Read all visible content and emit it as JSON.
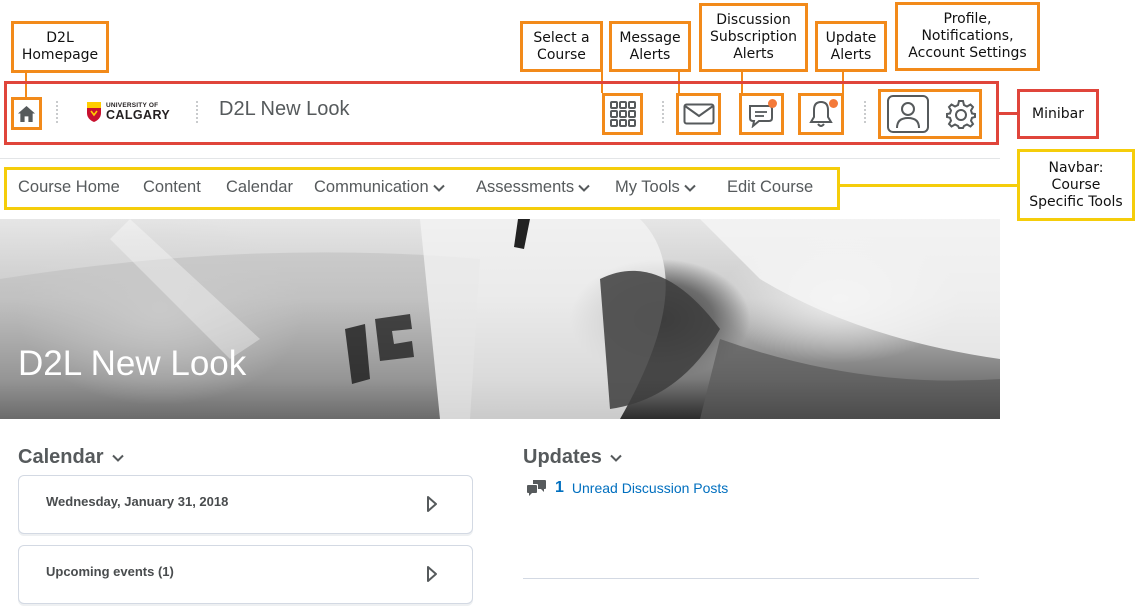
{
  "callouts": {
    "homepage": "D2L\nHomepage",
    "select_course": "Select a\nCourse",
    "message_alerts": "Message\nAlerts",
    "discussion_alerts": "Discussion\nSubscription\nAlerts",
    "update_alerts": "Update\nAlerts",
    "profile": "Profile,\nNotifications,\nAccount Settings",
    "minibar": "Minibar",
    "navbar": "Navbar:\nCourse\nSpecific Tools"
  },
  "minibar": {
    "logo_small": "UNIVERSITY OF",
    "logo_big": "CALGARY",
    "course_title": "D2L New Look"
  },
  "navbar": {
    "items": [
      {
        "label": "Course Home"
      },
      {
        "label": "Content"
      },
      {
        "label": "Calendar"
      },
      {
        "label": "Communication"
      },
      {
        "label": "Assessments"
      },
      {
        "label": "My Tools"
      },
      {
        "label": "Edit Course"
      }
    ]
  },
  "banner": {
    "title": "D2L New Look"
  },
  "calendar": {
    "title": "Calendar",
    "date_card": "Wednesday, January 31, 2018",
    "upcoming_card": "Upcoming events (1)"
  },
  "updates": {
    "title": "Updates",
    "count": "1",
    "link": "Unread Discussion Posts"
  },
  "colors": {
    "callout_orange": "#f28a1a",
    "minibar_red": "#e0453b",
    "navbar_yellow": "#f5cd0a",
    "link_blue": "#006fbf",
    "notification_dot": "#f47a3a"
  }
}
